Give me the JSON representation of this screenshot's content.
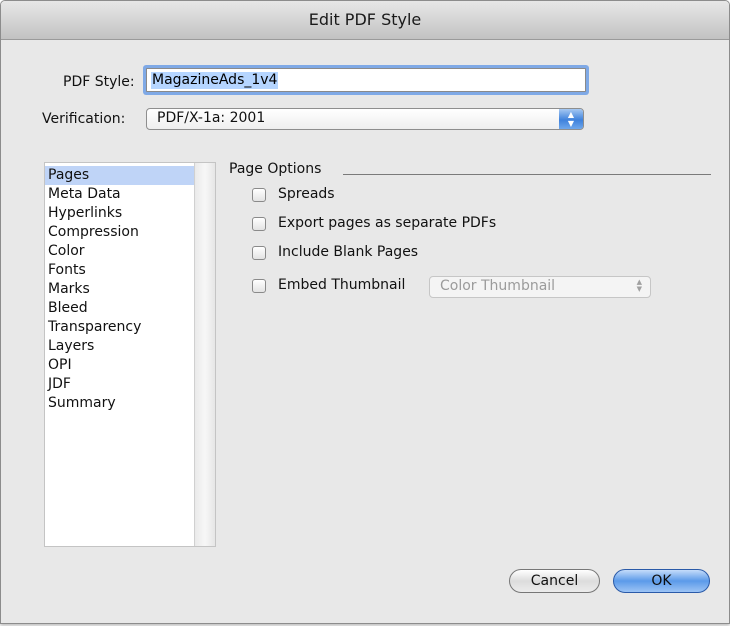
{
  "window": {
    "title": "Edit PDF Style"
  },
  "pdf_style": {
    "label": "PDF Style:",
    "value": "MagazineAds_1v4"
  },
  "verification": {
    "label": "Verification:",
    "value": "PDF/X-1a: 2001",
    "arrows_icon": "popup-arrows-icon"
  },
  "sidebar": {
    "items": [
      {
        "label": "Pages",
        "selected": true
      },
      {
        "label": "Meta Data",
        "selected": false
      },
      {
        "label": "Hyperlinks",
        "selected": false
      },
      {
        "label": "Compression",
        "selected": false
      },
      {
        "label": "Color",
        "selected": false
      },
      {
        "label": "Fonts",
        "selected": false
      },
      {
        "label": "Marks",
        "selected": false
      },
      {
        "label": "Bleed",
        "selected": false
      },
      {
        "label": "Transparency",
        "selected": false
      },
      {
        "label": "Layers",
        "selected": false
      },
      {
        "label": "OPI",
        "selected": false
      },
      {
        "label": "JDF",
        "selected": false
      },
      {
        "label": "Summary",
        "selected": false
      }
    ]
  },
  "page_options": {
    "group_label": "Page Options",
    "options": [
      {
        "label": "Spreads",
        "checked": false
      },
      {
        "label": "Export pages as separate PDFs",
        "checked": false
      },
      {
        "label": "Include Blank Pages",
        "checked": false
      },
      {
        "label": "Embed Thumbnail",
        "checked": false
      }
    ],
    "thumbnail_popup": {
      "value": "Color Thumbnail",
      "enabled": false
    }
  },
  "buttons": {
    "cancel_label": "Cancel",
    "ok_label": "OK"
  },
  "colors": {
    "accent": "#3f82dc",
    "selection": "#bfd4f7",
    "focus_ring": "#7fa9e6",
    "window_bg": "#e8e8e8"
  }
}
